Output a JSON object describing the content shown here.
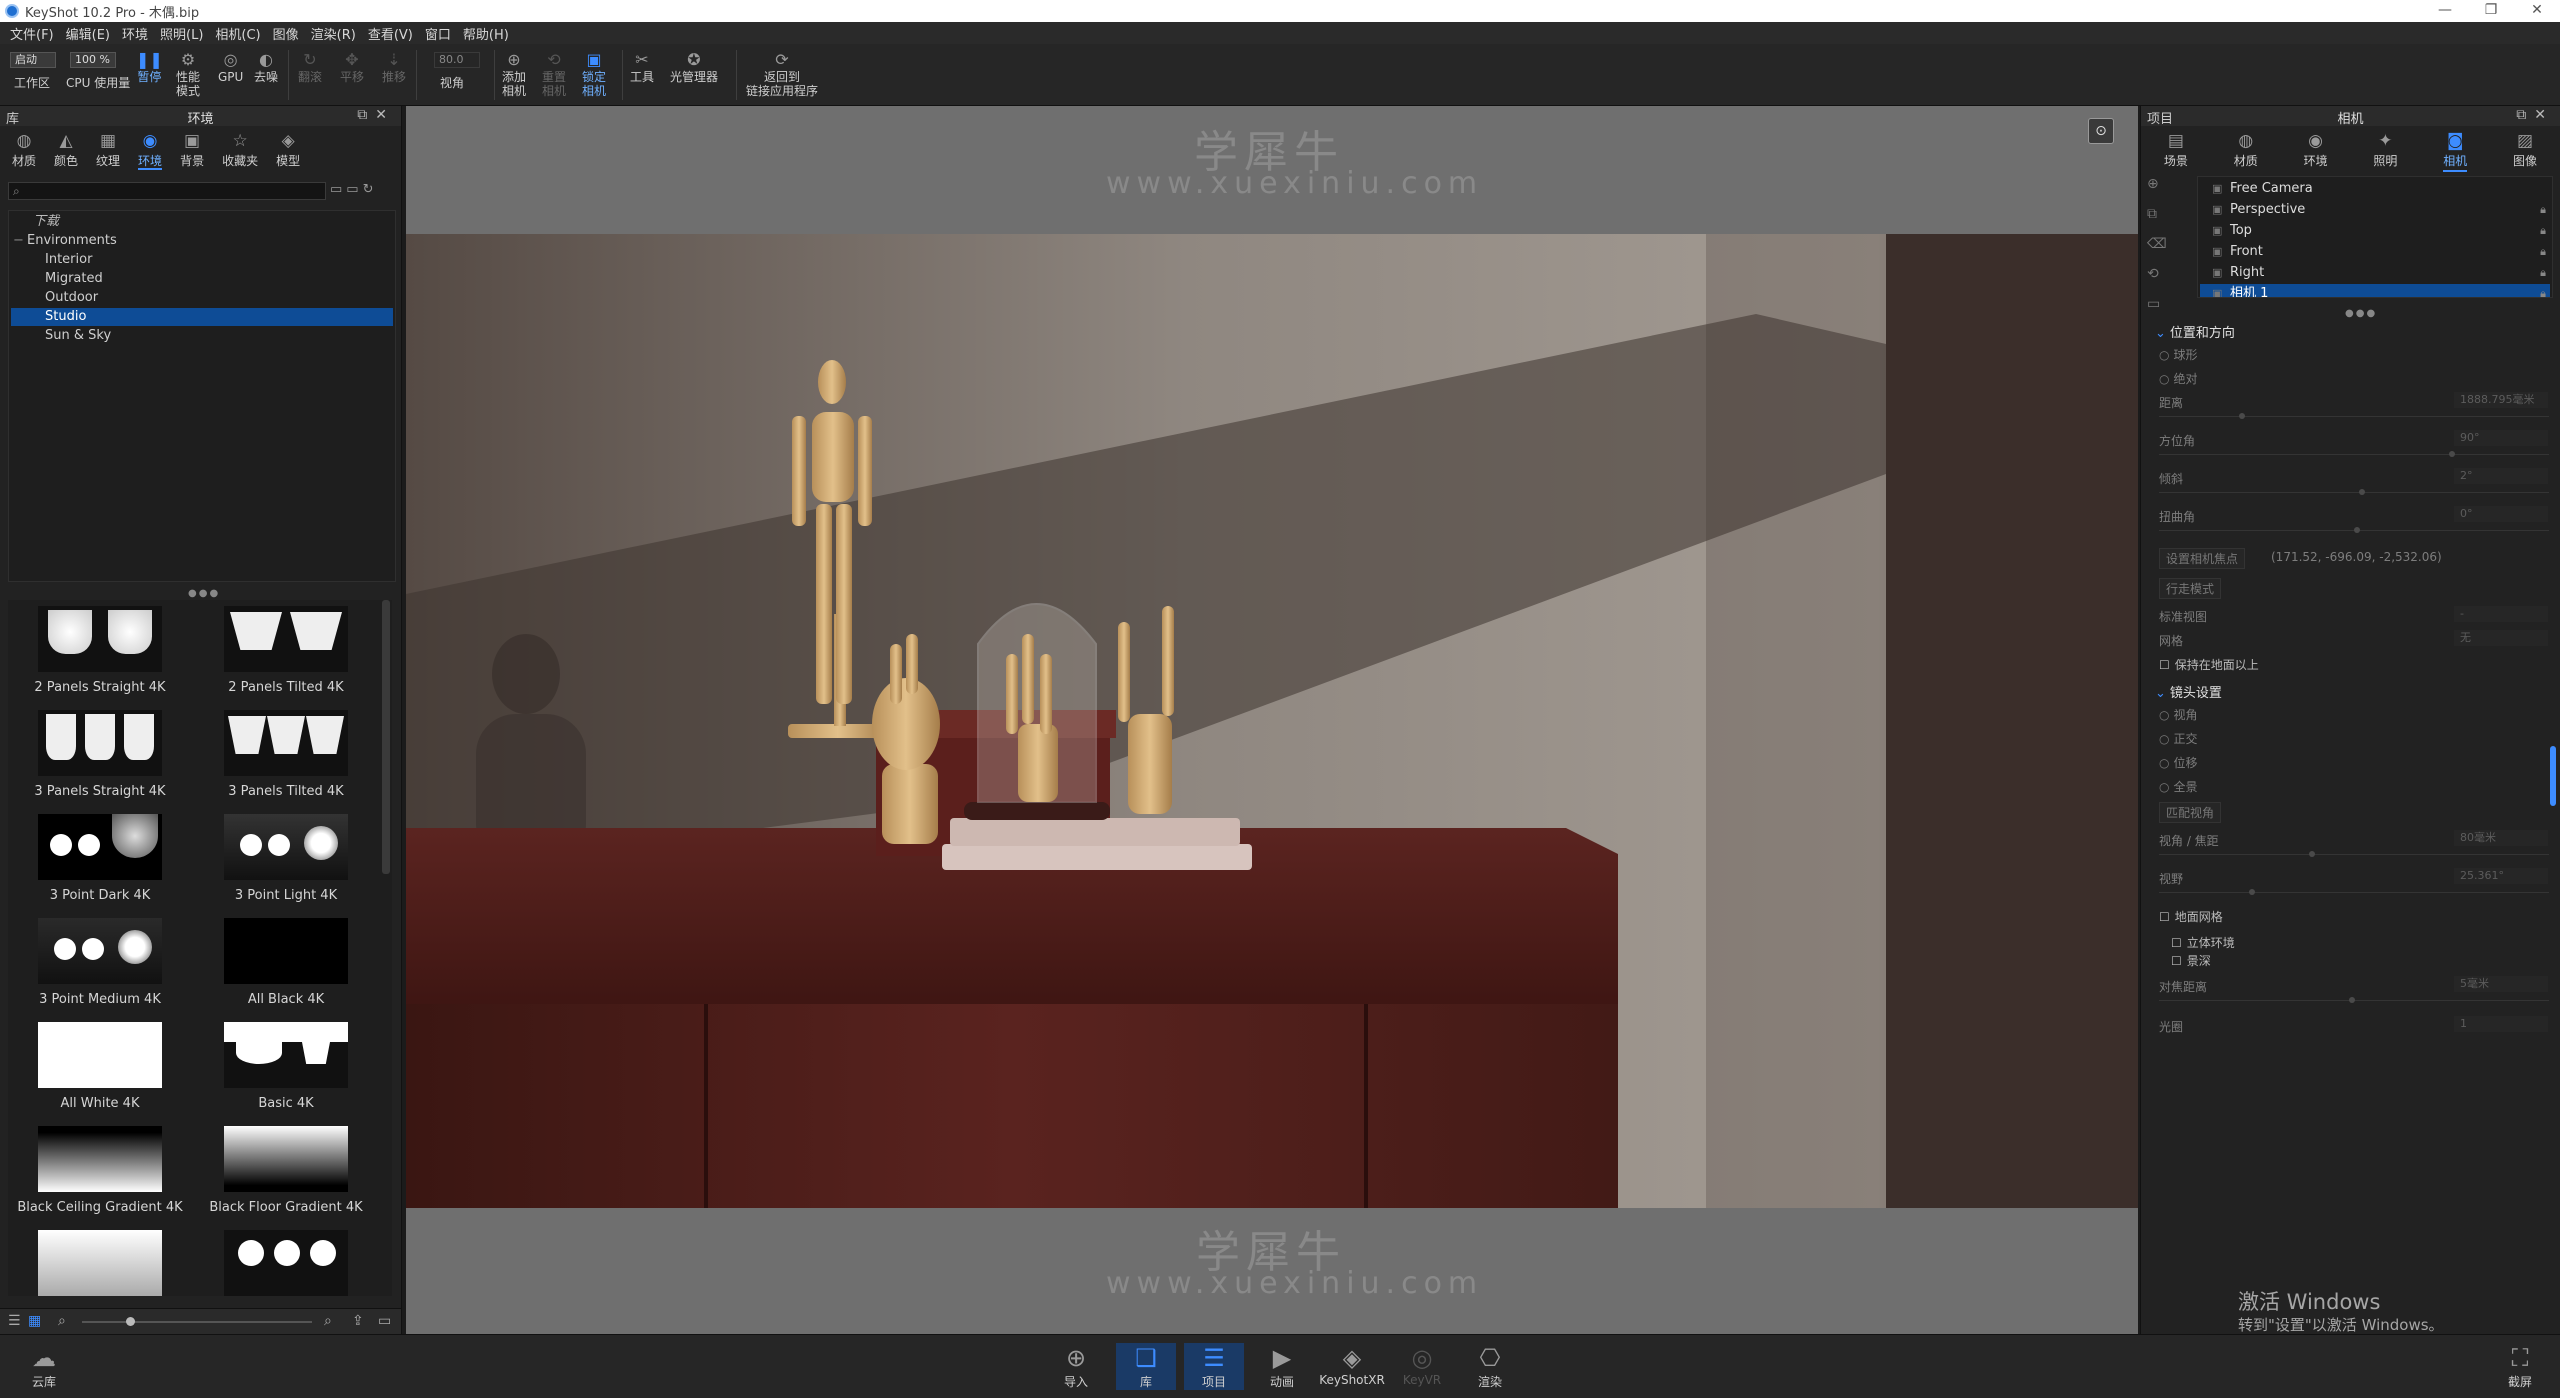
{
  "titlebar": {
    "title": "KeyShot 10.2 Pro  -  木偶.bip",
    "min": "—",
    "max": "❐",
    "close": "✕"
  },
  "menu": [
    "文件(F)",
    "编辑(E)",
    "环境",
    "照明(L)",
    "相机(C)",
    "图像",
    "渲染(R)",
    "查看(V)",
    "窗口",
    "帮助(H)"
  ],
  "toolbar": {
    "preset_value": "启动",
    "zoom_value": "100 %",
    "fov_value": "80.0",
    "items": {
      "workspace": "工作区",
      "cpu": "CPU 使用量",
      "pause": "暂停",
      "perf": "性能\n模式",
      "gpu": "GPU",
      "denoise": "去噪",
      "tumble": "翻滚",
      "pan": "平移",
      "dolly": "推移",
      "view": "视角",
      "add_cam": "添加\n相机",
      "reset_cam": "重置\n相机",
      "lock_cam": "锁定\n相机",
      "tools": "工具",
      "light_mgr": "光管理器",
      "back_link": "返回到\n链接应用程序"
    }
  },
  "left_panel": {
    "title_left": "库",
    "title_center": "环境",
    "tabs": [
      {
        "label": "材质",
        "icon": "◍"
      },
      {
        "label": "颜色",
        "icon": "◭"
      },
      {
        "label": "纹理",
        "icon": "▦"
      },
      {
        "label": "环境",
        "icon": "◉"
      },
      {
        "label": "背景",
        "icon": "▣"
      },
      {
        "label": "收藏夹",
        "icon": "☆"
      },
      {
        "label": "模型",
        "icon": "◈"
      }
    ],
    "search_placeholder": "",
    "tree": {
      "favorites": "下载",
      "root": "Environments",
      "children": [
        "Interior",
        "Migrated",
        "Outdoor",
        "Studio",
        "Sun & Sky"
      ]
    },
    "thumbnails": [
      "2 Panels Straight 4K",
      "2 Panels Tilted 4K",
      "3 Panels Straight 4K",
      "3 Panels Tilted 4K",
      "3 Point Dark 4K",
      "3 Point Light 4K",
      "3 Point Medium 4K",
      "All Black 4K",
      "All White 4K",
      "Basic 4K",
      "Black Ceiling Gradient 4K",
      "Black Floor Gradient 4K"
    ]
  },
  "viewport": {
    "watermark_top_cn": "学犀牛",
    "watermark_top_en": "www.xuexiniu.com",
    "watermark_bottom_cn": "学犀牛",
    "watermark_bottom_en": "www.xuexiniu.com"
  },
  "right_panel": {
    "title_left": "项目",
    "title_center": "相机",
    "tabs": [
      {
        "label": "场景",
        "icon": "▤"
      },
      {
        "label": "材质",
        "icon": "◍"
      },
      {
        "label": "环境",
        "icon": "◉"
      },
      {
        "label": "照明",
        "icon": "✦"
      },
      {
        "label": "相机",
        "icon": "◙"
      },
      {
        "label": "图像",
        "icon": "▨"
      }
    ],
    "cameras": [
      "Free Camera",
      "Perspective",
      "Top",
      "Front",
      "Right",
      "相机 1"
    ],
    "pos_section": "位置和方向",
    "orbit": "球形",
    "absolute": "绝对",
    "distance_label": "距离",
    "distance_value": "1888.795毫米",
    "azimuth_label": "方位角",
    "azimuth_value": "90°",
    "incl_label": "倾斜",
    "incl_value": "2°",
    "twist_label": "扭曲角",
    "twist_value": "0°",
    "pivot_label": "设置相机焦点",
    "pivot_value": "(171.52, -696.09, -2,532.06)",
    "walk_label": "行走模式",
    "std_view_label": "标准视图",
    "std_view_value": "-",
    "grid_label": "网格",
    "grid_value": "无",
    "keep_above": "保持在地面以上",
    "lens_section": "镜头设置",
    "lens_persp": "视角",
    "lens_ortho": "正交",
    "lens_shift": "位移",
    "lens_pano": "全景",
    "match_persp": "匹配视角",
    "focal_label": "视角 / 焦距",
    "focal_value": "80毫米",
    "fov_label": "视野",
    "fov_value": "25.361°",
    "ground_grid": "地面网格",
    "stereo": "立体环境",
    "dof": "景深",
    "focus_label": "对焦距离",
    "focus_value": "5毫米",
    "aperture_label": "光圈",
    "aperture_value": "1",
    "win_act_1": "激活 Windows",
    "win_act_2": "转到\"设置\"以激活 Windows。"
  },
  "bottom": {
    "cloud": "云库",
    "import": "导入",
    "library": "库",
    "project": "项目",
    "animation": "动画",
    "keyshotxr": "KeyShotXR",
    "keyvr": "KeyVR",
    "render": "渲染",
    "screenshot": "截屏"
  }
}
